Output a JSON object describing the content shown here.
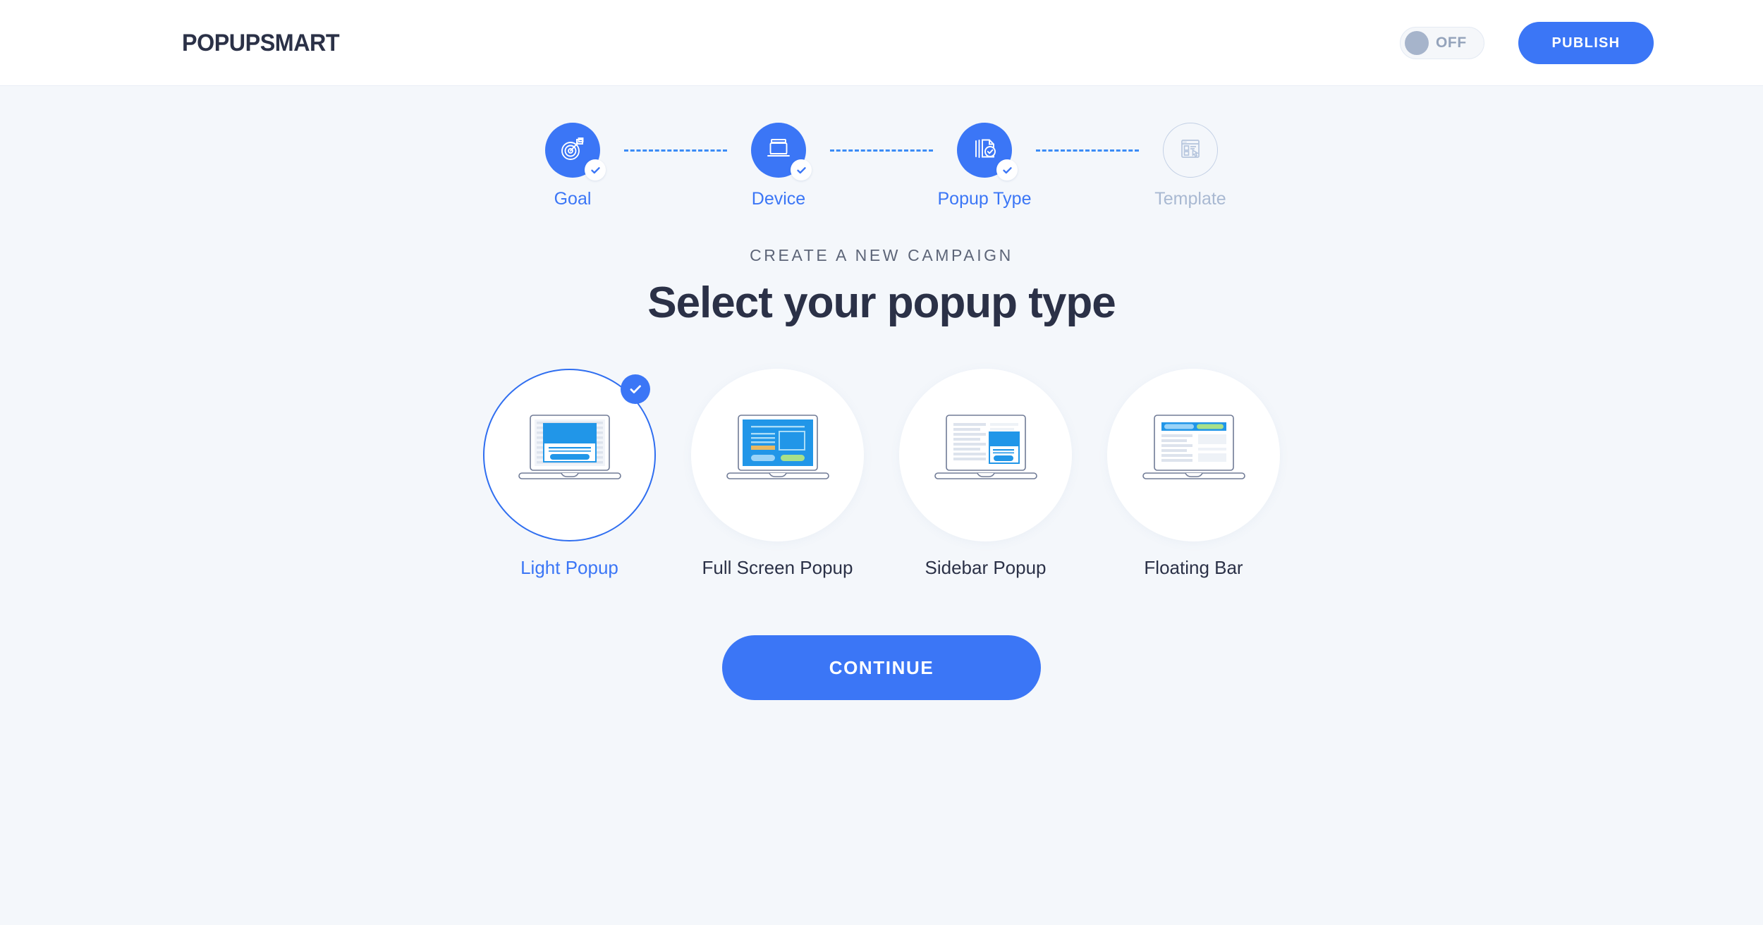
{
  "header": {
    "logo": "POPUPSMART",
    "toggle": {
      "label": "OFF",
      "state": "off"
    },
    "publish_label": "PUBLISH",
    "accent_color": "#3b76f6"
  },
  "stepper": {
    "steps": [
      {
        "label": "Goal",
        "icon": "target-flag-icon",
        "state": "completed"
      },
      {
        "label": "Device",
        "icon": "laptop-device-icon",
        "state": "completed"
      },
      {
        "label": "Popup Type",
        "icon": "documents-check-icon",
        "state": "completed"
      },
      {
        "label": "Template",
        "icon": "browser-cursor-icon",
        "state": "inactive"
      }
    ],
    "active_color": "#3b76f6",
    "inactive_color": "#a9b9d2"
  },
  "main": {
    "eyebrow": "CREATE A NEW CAMPAIGN",
    "title": "Select your popup type",
    "cards": [
      {
        "label": "Light Popup",
        "icon": "light-popup-preview-icon",
        "selected": true
      },
      {
        "label": "Full Screen Popup",
        "icon": "full-screen-popup-preview-icon",
        "selected": false
      },
      {
        "label": "Sidebar Popup",
        "icon": "sidebar-popup-preview-icon",
        "selected": false
      },
      {
        "label": "Floating Bar",
        "icon": "floating-bar-preview-icon",
        "selected": false
      }
    ],
    "continue_label": "CONTINUE"
  },
  "colors": {
    "page_background": "#f4f7fb",
    "header_background": "#ffffff",
    "blue": "#3b76f6",
    "preview_blue": "#2196e8",
    "preview_green": "#a8e08a",
    "preview_orange": "#eab860",
    "preview_light_blue": "#9ad3f7",
    "text_dark": "#2b3147",
    "text_muted": "#5d6578"
  }
}
